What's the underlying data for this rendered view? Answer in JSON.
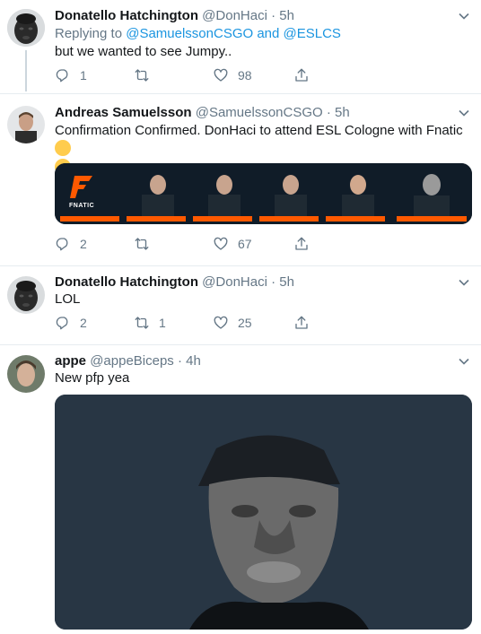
{
  "tweets": [
    {
      "name": "Donatello Hatchington",
      "handle": "@DonHaci",
      "sep": "·",
      "time": "5h",
      "replying_prefix": "Replying to",
      "replying_to": "@SamuelssonCSGO and @ESLCS",
      "text": "but we wanted to see Jumpy..",
      "reply_count": "1",
      "retweet_count": "",
      "like_count": "98"
    },
    {
      "name": "Andreas Samuelsson",
      "handle": "@SamuelssonCSGO",
      "sep": "·",
      "time": "5h",
      "text": "Confirmation Confirmed. DonHaci to attend ESL Cologne with Fnatic",
      "reply_count": "2",
      "retweet_count": "",
      "like_count": "67",
      "media": {
        "logo_text": "FNATIC",
        "players": [
          "",
          "",
          "",
          "",
          "",
          ""
        ]
      }
    },
    {
      "name": "Donatello Hatchington",
      "handle": "@DonHaci",
      "sep": "·",
      "time": "5h",
      "text": "LOL",
      "reply_count": "2",
      "retweet_count": "1",
      "like_count": "25"
    },
    {
      "name": "appe",
      "handle": "@appeBiceps",
      "sep": "·",
      "time": "4h",
      "text": "New pfp yea"
    }
  ],
  "colors": {
    "text": "#14171a",
    "secondary": "#657786",
    "link": "#1b95e0",
    "divider": "#e6ecf0",
    "fnatic_orange": "#ff5900"
  },
  "icons": [
    "reply-icon",
    "retweet-icon",
    "like-icon",
    "share-icon",
    "caret-down-icon"
  ]
}
